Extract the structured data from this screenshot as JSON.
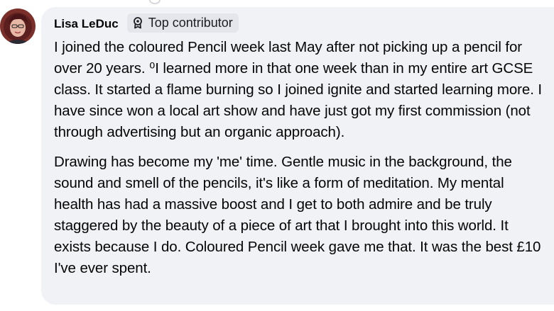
{
  "comment": {
    "author": "Lisa LeDuc",
    "badge_label": "Top contributor",
    "badge_icon": "contributor-badge-icon",
    "paragraphs": [
      "I joined the coloured Pencil week last May after not picking up a pencil for over 20 years. ⁰I learned more in that one week than in my entire art GCSE class. It started a flame burning so I joined ignite and started learning more. I have since won a local art show and have just got my first commission (not through advertising but an organic approach).",
      "Drawing has become my 'me' time. Gentle music in the background, the sound and smell of the pencils, it's like a form of meditation. My mental health has had a massive boost and I get to both admire and be truly staggered by the beauty of a piece of art that I brought into this world. It exists because I do. Coloured Pencil week gave me that. It was the best £10 I've ever spent."
    ]
  },
  "colors": {
    "bubble_bg": "#f0f2f5",
    "badge_bg": "#e4e6eb",
    "text": "#050505"
  }
}
